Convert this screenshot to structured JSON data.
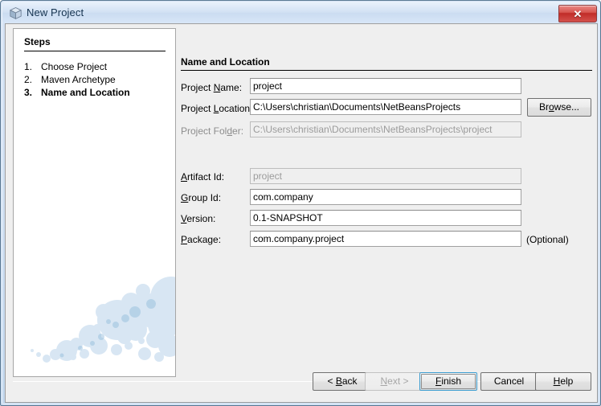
{
  "window": {
    "title": "New Project",
    "icon": "project-cube-icon",
    "close_label": "✕",
    "accent_blue": "#3c9dd0",
    "titlebar_color": "#d3e2f4",
    "close_color": "#c02c28"
  },
  "steps_panel": {
    "heading": "Steps",
    "items": [
      {
        "number": "1.",
        "label": "Choose Project",
        "current": false
      },
      {
        "number": "2.",
        "label": "Maven Archetype",
        "current": false
      },
      {
        "number": "3.",
        "label": "Name and Location",
        "current": true
      }
    ]
  },
  "content": {
    "heading": "Name and Location",
    "fields": [
      {
        "name": "project-name",
        "label_pre": "Project ",
        "label_mn": "N",
        "label_post": "ame:",
        "value": "project",
        "placeholder": "",
        "readonly": false
      },
      {
        "name": "project-location",
        "label_pre": "Project ",
        "label_mn": "L",
        "label_post": "ocation:",
        "value": "C:\\Users\\christian\\Documents\\NetBeansProjects",
        "placeholder": "",
        "readonly": false
      },
      {
        "name": "project-folder",
        "label_pre": "Project Fol",
        "label_mn": "d",
        "label_post": "er:",
        "value": "C:\\Users\\christian\\Documents\\NetBeansProjects\\project",
        "placeholder": "",
        "readonly": true
      },
      {
        "name": "artifact-id",
        "label_pre": "",
        "label_mn": "A",
        "label_post": "rtifact Id:",
        "value": "project",
        "placeholder": "",
        "readonly": true
      },
      {
        "name": "group-id",
        "label_pre": "",
        "label_mn": "G",
        "label_post": "roup Id:",
        "value": "com.company",
        "placeholder": "",
        "readonly": false
      },
      {
        "name": "version",
        "label_pre": "",
        "label_mn": "V",
        "label_post": "ersion:",
        "value": "0.1-SNAPSHOT",
        "placeholder": "",
        "readonly": false
      },
      {
        "name": "package",
        "label_pre": "",
        "label_mn": "P",
        "label_post": "ackage:",
        "value": "com.company.project",
        "placeholder": "",
        "readonly": false
      }
    ],
    "browse_button": {
      "pre": "Br",
      "mn": "o",
      "post": "wse..."
    },
    "optional_note": "(Optional)"
  },
  "buttons": {
    "back": {
      "pre": "< ",
      "mn": "B",
      "post": "ack",
      "disabled": false,
      "default": false
    },
    "next": {
      "pre": "",
      "mn": "N",
      "post": "ext >",
      "disabled": true,
      "default": false
    },
    "finish": {
      "pre": "",
      "mn": "F",
      "post": "inish",
      "disabled": false,
      "default": true
    },
    "cancel": {
      "pre": "Cancel",
      "mn": "",
      "post": "",
      "disabled": false,
      "default": false
    },
    "help": {
      "pre": "",
      "mn": "H",
      "post": "elp",
      "disabled": false,
      "default": false
    }
  }
}
